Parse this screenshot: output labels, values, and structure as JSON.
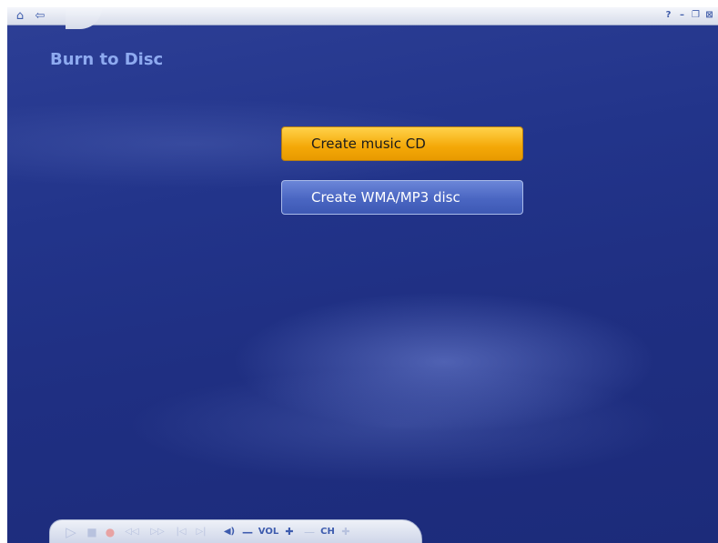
{
  "topbar": {
    "nav": [
      {
        "name": "home-icon",
        "glyph": "⌂"
      },
      {
        "name": "back-arrow-icon",
        "glyph": "⇦"
      }
    ],
    "window_controls": [
      {
        "name": "help-icon",
        "glyph": "?"
      },
      {
        "name": "minimize-icon",
        "glyph": "–"
      },
      {
        "name": "restore-icon",
        "glyph": "❐"
      },
      {
        "name": "close-icon",
        "glyph": "⊠"
      }
    ]
  },
  "page": {
    "title": "Burn to Disc"
  },
  "menu": {
    "create_music_cd": "Create music CD",
    "create_wma_mp3": "Create WMA/MP3 disc"
  },
  "transport": {
    "play": "▷",
    "stop": "■",
    "record": "●",
    "rewind": "◁◁",
    "fast_forward": "▷▷",
    "skip_back": "|◁",
    "skip_forward": "▷|",
    "mute": "◀)",
    "vol_minus": "—",
    "vol_label": "VOL",
    "vol_plus": "✚",
    "ch_minus": "—",
    "ch_label": "CH",
    "ch_plus": "✚"
  },
  "colors": {
    "background": "#22348a",
    "title_text": "#8eaaf0",
    "focused_button": "#f4a807",
    "normal_button": "#4a66c2"
  }
}
